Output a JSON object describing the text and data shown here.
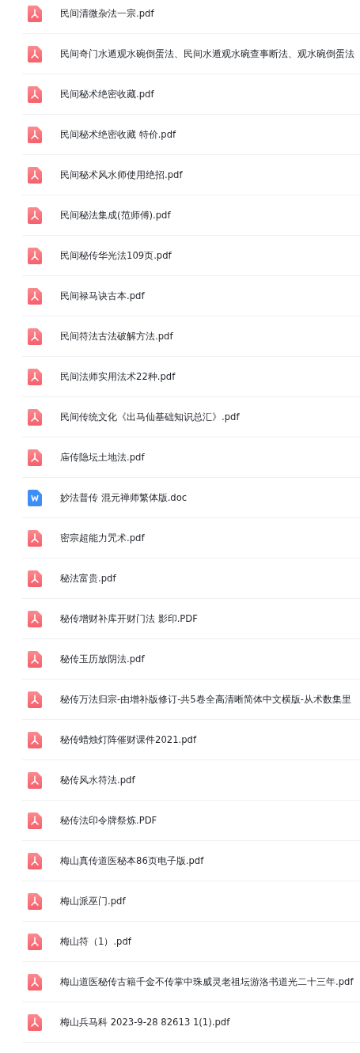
{
  "files": [
    {
      "kind": "pdf",
      "name": "民间清微杂法一宗.pdf"
    },
    {
      "kind": "pdf",
      "name": "民间奇门水遁观水碗倒蛋法、民间水遁观水碗查事断法、观水碗倒蛋法"
    },
    {
      "kind": "pdf",
      "name": "民间秘术绝密收藏.pdf"
    },
    {
      "kind": "pdf",
      "name": "民间秘术绝密收藏 特价.pdf"
    },
    {
      "kind": "pdf",
      "name": "民间秘术风水师使用绝招.pdf"
    },
    {
      "kind": "pdf",
      "name": "民间秘法集成(范师傅).pdf"
    },
    {
      "kind": "pdf",
      "name": "民间秘传华光法109页.pdf"
    },
    {
      "kind": "pdf",
      "name": "民间禄马诀古本.pdf"
    },
    {
      "kind": "pdf",
      "name": "民间符法古法破解方法.pdf"
    },
    {
      "kind": "pdf",
      "name": "民间法师实用法术22种.pdf"
    },
    {
      "kind": "pdf",
      "name": "民间传统文化《出马仙基础知识总汇》.pdf"
    },
    {
      "kind": "pdf",
      "name": "庙传隐坛土地法.pdf"
    },
    {
      "kind": "doc",
      "name": "妙法普传 混元禅师繁体版.doc"
    },
    {
      "kind": "pdf",
      "name": "密宗超能力咒术.pdf"
    },
    {
      "kind": "pdf",
      "name": "秘法富贵.pdf"
    },
    {
      "kind": "pdf",
      "name": "秘传增财补库开财门法 影印.PDF"
    },
    {
      "kind": "pdf",
      "name": "秘传玉历放阴法.pdf"
    },
    {
      "kind": "pdf",
      "name": "秘传万法归宗-由增补版修订-共5卷全高清晰简体中文横版-从术数集里"
    },
    {
      "kind": "pdf",
      "name": "秘传蜡烛灯阵催财课件2021.pdf"
    },
    {
      "kind": "pdf",
      "name": "秘传风水符法.pdf"
    },
    {
      "kind": "pdf",
      "name": "秘传法印令牌祭炼.PDF"
    },
    {
      "kind": "pdf",
      "name": "梅山真传道医秘本86页电子版.pdf"
    },
    {
      "kind": "pdf",
      "name": "梅山派巫门.pdf"
    },
    {
      "kind": "pdf",
      "name": "梅山符（1）.pdf"
    },
    {
      "kind": "pdf",
      "name": "梅山道医秘传古籍千金不传掌中珠威灵老祖坛游洛书道光二十三年.pdf"
    },
    {
      "kind": "pdf",
      "name": "梅山兵马科 2023-9-28 82613 1(1).pdf"
    }
  ]
}
